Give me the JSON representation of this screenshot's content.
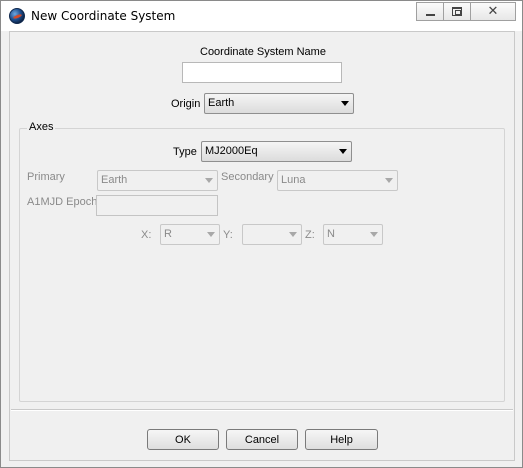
{
  "window": {
    "title": "New Coordinate System",
    "close_glyph": "✕"
  },
  "form": {
    "name_label": "Coordinate System Name",
    "name_value": "",
    "origin_label": "Origin",
    "origin_value": "Earth"
  },
  "axes": {
    "group_label": "Axes",
    "type_label": "Type",
    "type_value": "MJ2000Eq",
    "primary_label": "Primary",
    "primary_value": "Earth",
    "secondary_label": "Secondary",
    "secondary_value": "Luna",
    "epoch_label": "A1MJD Epoch",
    "epoch_value": "",
    "x_label": "X:",
    "x_value": "R",
    "y_label": "Y:",
    "y_value": "",
    "z_label": "Z:",
    "z_value": "N"
  },
  "buttons": {
    "ok": "OK",
    "cancel": "Cancel",
    "help": "Help"
  },
  "icons": {
    "app": "globe-app-icon",
    "minimize": "minimize-icon",
    "maximize": "maximize-icon",
    "close": "close-icon"
  }
}
